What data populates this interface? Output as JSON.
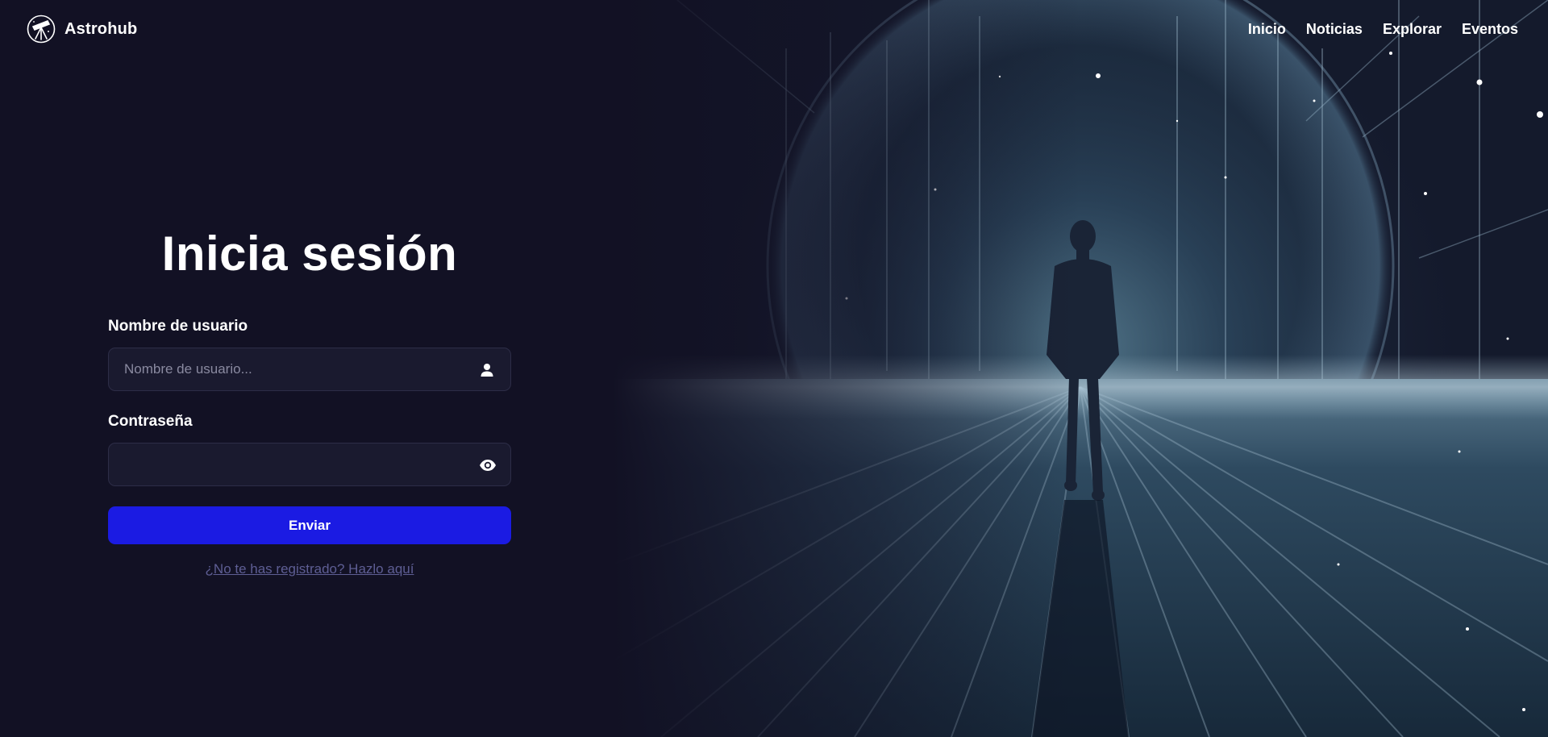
{
  "header": {
    "brand_name": "Astrohub",
    "nav": [
      {
        "label": "Inicio"
      },
      {
        "label": "Noticias"
      },
      {
        "label": "Explorar"
      },
      {
        "label": "Eventos"
      }
    ]
  },
  "login": {
    "title": "Inicia sesión",
    "username": {
      "label": "Nombre de usuario",
      "placeholder": "Nombre de usuario...",
      "value": "",
      "icon": "user-icon"
    },
    "password": {
      "label": "Contraseña",
      "placeholder": "",
      "value": "",
      "icon": "eye-icon"
    },
    "submit_label": "Enviar",
    "register_link": "¿No te has registrado? Hazlo aquí"
  },
  "colors": {
    "background": "#121124",
    "accent": "#1b1be3",
    "link": "#5e5e94",
    "input_bg": "#1a1a2f"
  }
}
